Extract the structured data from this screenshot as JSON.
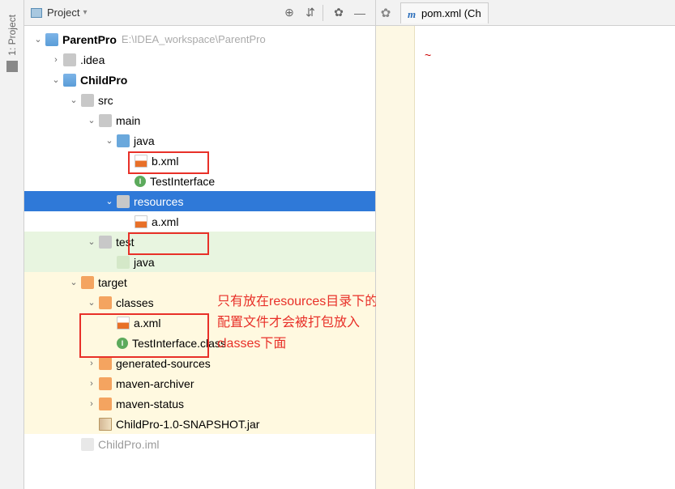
{
  "sidebar": {
    "tab_label": "1: Project"
  },
  "panel": {
    "title": "Project",
    "toolbar_icons": [
      "locate-icon",
      "collapse-icon",
      "settings-icon",
      "hide-icon"
    ]
  },
  "tree": {
    "root": {
      "name": "ParentPro",
      "path": "E:\\IDEA_workspace\\ParentPro"
    },
    "idea": ".idea",
    "childpro": "ChildPro",
    "src": "src",
    "main": "main",
    "java1": "java",
    "b_xml": "b.xml",
    "test_interface": "TestInterface",
    "resources": "resources",
    "a_xml": "a.xml",
    "test": "test",
    "java2": "java",
    "target": "target",
    "classes": "classes",
    "a_xml2": "a.xml",
    "test_interface_class": "TestInterface.class",
    "generated_sources": "generated-sources",
    "maven_archiver": "maven-archiver",
    "maven_status": "maven-status",
    "snapshot_jar": "ChildPro-1.0-SNAPSHOT.jar",
    "childpro_iml": "ChildPro.iml"
  },
  "annotation": {
    "text": "只有放在resources目录下的配置文件才会被打包放入classes下面"
  },
  "editor": {
    "tab_label": "pom.xml (Ch",
    "squiggle": "~"
  }
}
